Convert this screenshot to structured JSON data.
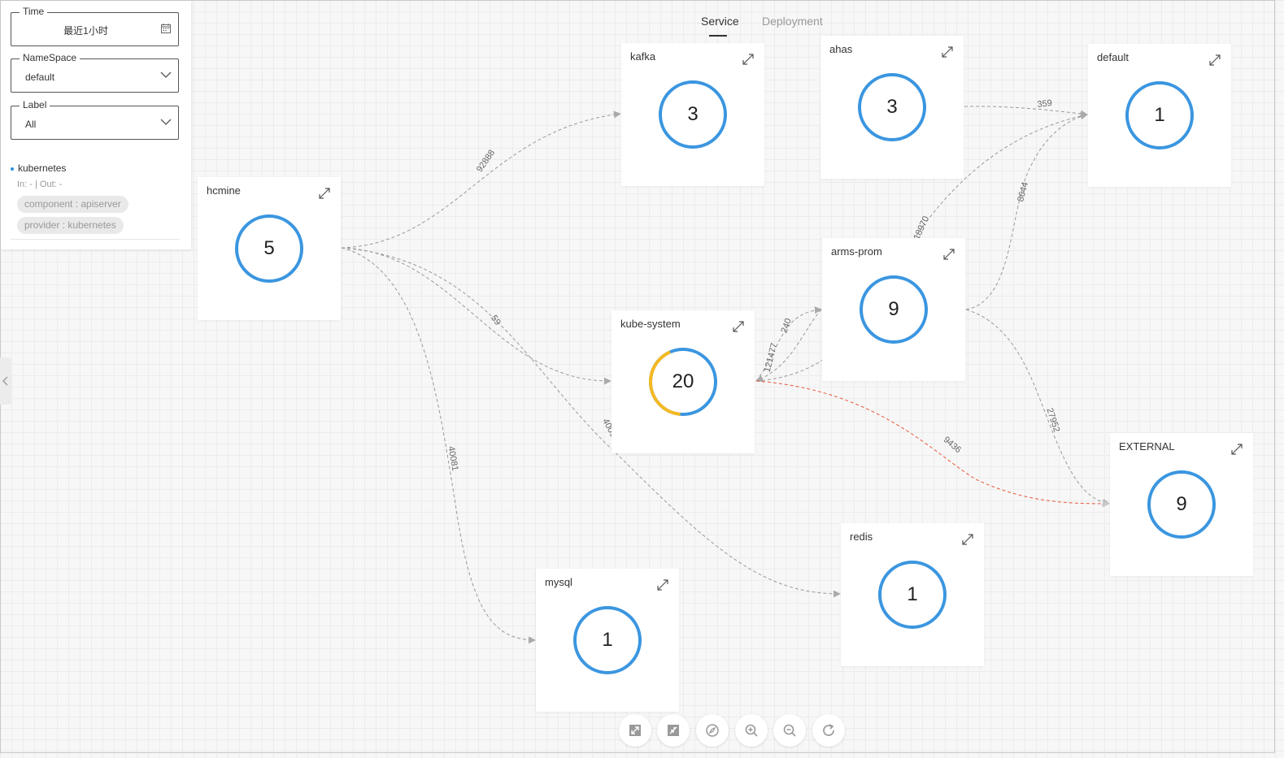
{
  "filters": {
    "time": {
      "label": "Time",
      "value": "最近1小时"
    },
    "namespace": {
      "label": "NameSpace",
      "value": "default"
    },
    "label": {
      "label": "Label",
      "value": "All"
    },
    "selected": {
      "name": "kubernetes",
      "in_out": "In: - | Out: -",
      "tags": [
        "component : apiserver",
        "provider : kubernetes"
      ]
    }
  },
  "tabs": [
    {
      "label": "Service",
      "active": true
    },
    {
      "label": "Deployment",
      "active": false
    }
  ],
  "nodes": [
    {
      "id": "kafka",
      "name": "kafka",
      "count": "3"
    },
    {
      "id": "ahas",
      "name": "ahas",
      "count": "3"
    },
    {
      "id": "default",
      "name": "default",
      "count": "1"
    },
    {
      "id": "hcmine",
      "name": "hcmine",
      "count": "5"
    },
    {
      "id": "arms-prom",
      "name": "arms-prom",
      "count": "9"
    },
    {
      "id": "kube-system",
      "name": "kube-system",
      "count": "20",
      "warning_fraction": 0.42
    },
    {
      "id": "external",
      "name": "EXTERNAL",
      "count": "9"
    },
    {
      "id": "redis",
      "name": "redis",
      "count": "1"
    },
    {
      "id": "mysql",
      "name": "mysql",
      "count": "1"
    }
  ],
  "edges": [
    {
      "from": "hcmine",
      "to": "kafka",
      "value": "92888",
      "status": "normal"
    },
    {
      "from": "hcmine",
      "to": "kube-system",
      "value": "59",
      "status": "normal"
    },
    {
      "from": "hcmine",
      "to": "redis",
      "value": "40092",
      "status": "normal"
    },
    {
      "from": "hcmine",
      "to": "mysql",
      "value": "40081",
      "status": "normal"
    },
    {
      "from": "ahas",
      "to": "default",
      "value": "359",
      "status": "normal"
    },
    {
      "from": "kube-system",
      "to": "arms-prom",
      "value": "240",
      "status": "normal"
    },
    {
      "from": "arms-prom",
      "to": "kube-system",
      "value": "121477",
      "status": "normal"
    },
    {
      "from": "kube-system",
      "to": "default",
      "value": "18970",
      "status": "normal"
    },
    {
      "from": "arms-prom",
      "to": "default",
      "value": "8644",
      "status": "normal"
    },
    {
      "from": "arms-prom",
      "to": "external",
      "value": "27952",
      "status": "normal"
    },
    {
      "from": "kube-system",
      "to": "external",
      "value": "9436",
      "status": "error"
    }
  ],
  "colors": {
    "ring": "#3b96e0",
    "warning": "#f5b921",
    "edge": "#999999",
    "error_edge": "#e8563a"
  },
  "toolbar": [
    {
      "name": "fit-view",
      "icon": "fullscreen-icon"
    },
    {
      "name": "shrink-view",
      "icon": "shrink-icon"
    },
    {
      "name": "locate",
      "icon": "compass-icon"
    },
    {
      "name": "zoom-in",
      "icon": "zoom-in-icon"
    },
    {
      "name": "zoom-out",
      "icon": "zoom-out-icon"
    },
    {
      "name": "refresh",
      "icon": "refresh-icon"
    }
  ]
}
